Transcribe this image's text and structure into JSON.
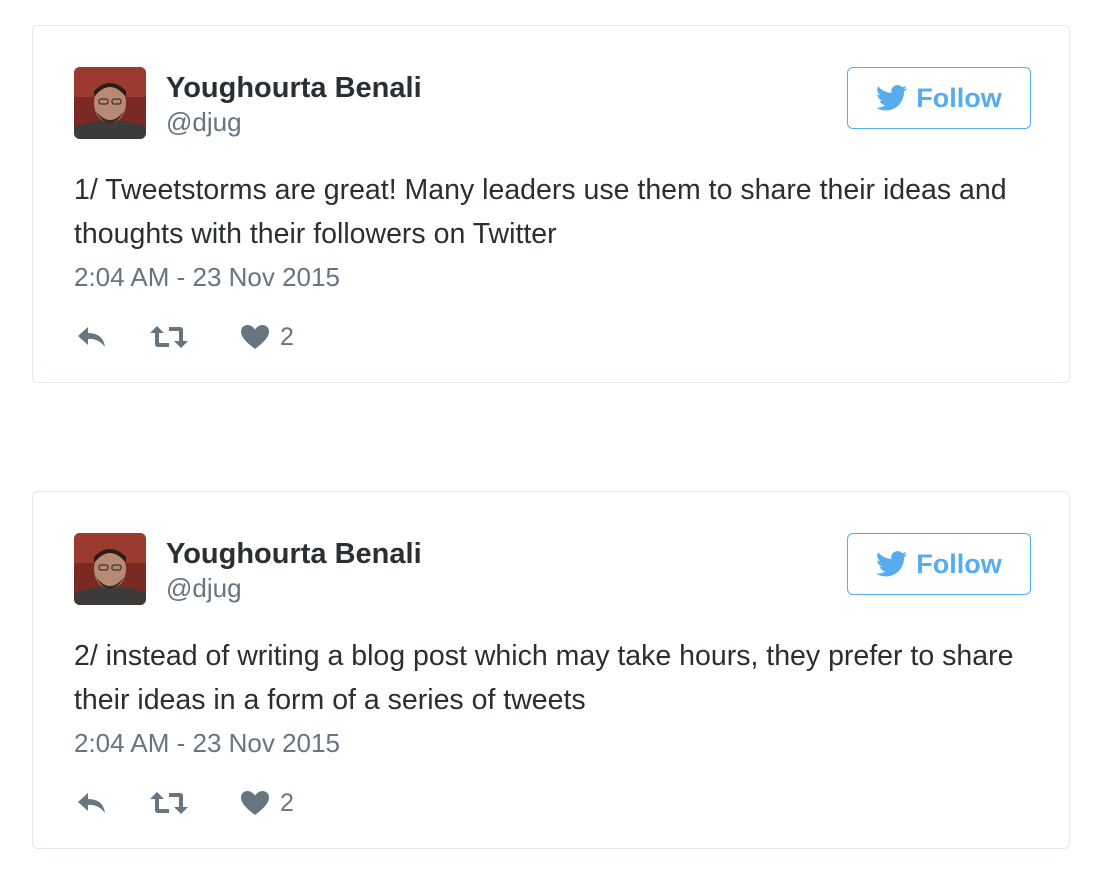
{
  "colors": {
    "accent": "#55acee",
    "text": "#292f33",
    "muted": "#66757f",
    "border": "#e1e8ed"
  },
  "tweets": [
    {
      "author": {
        "name": "Youghourta Benali",
        "handle": "@djug"
      },
      "follow_label": "Follow",
      "text": "1/ Tweetstorms are great! Many leaders use them to share their ideas and thoughts with their followers on Twitter",
      "timestamp": "2:04 AM - 23 Nov 2015",
      "likes": "2",
      "icons": [
        "twitter-bird-icon",
        "reply-icon",
        "retweet-icon",
        "heart-icon"
      ]
    },
    {
      "author": {
        "name": "Youghourta Benali",
        "handle": "@djug"
      },
      "follow_label": "Follow",
      "text": "2/ instead of writing a blog post which may take hours, they prefer to share their ideas in a form of a series of tweets",
      "timestamp": "2:04 AM - 23 Nov 2015",
      "likes": "2",
      "icons": [
        "twitter-bird-icon",
        "reply-icon",
        "retweet-icon",
        "heart-icon"
      ]
    }
  ]
}
